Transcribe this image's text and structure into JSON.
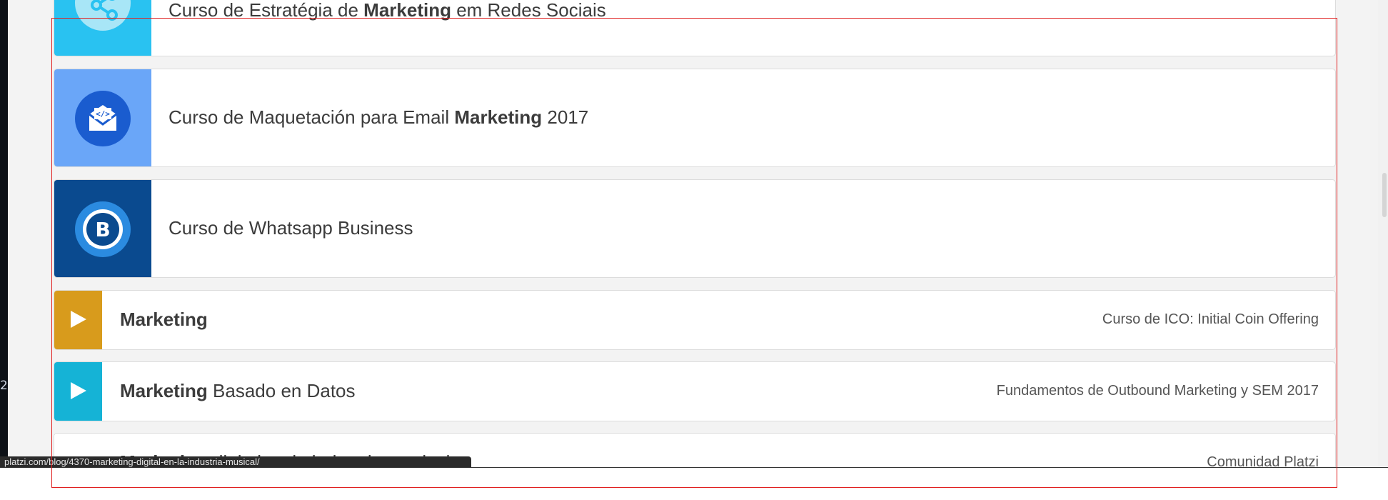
{
  "cards": [
    {
      "prefix": "Curso de Estratégia de ",
      "bold": "Marketing",
      "suffix": " em Redes Sociais",
      "icon": "share-icon",
      "thumb_color": "#29c2f1"
    },
    {
      "prefix": "Curso de Maquetación para Email ",
      "bold": "Marketing",
      "suffix": " 2017",
      "icon": "email-code-icon",
      "thumb_color": "#6aa6f8"
    },
    {
      "prefix": "Curso de Whatsapp Business",
      "bold": "",
      "suffix": "",
      "icon": "whatsapp-business-icon",
      "thumb_color": "#0a4a8f"
    }
  ],
  "rows": [
    {
      "bold": "Marketing",
      "rest": "",
      "meta": "Curso de ICO: Initial Coin Offering",
      "color": "#d89b1c",
      "icon": "play-icon"
    },
    {
      "bold": "Marketing",
      "rest": " Basado en Datos",
      "meta": "Fundamentos de Outbound Marketing y SEM 2017",
      "color": "#15b3d6",
      "icon": "play-icon"
    },
    {
      "bold": "Marketing",
      "rest": " digital en la industria musical",
      "meta": "Comunidad Platzi",
      "color": "#ffffff",
      "icon": "play-icon"
    }
  ],
  "status_url": "platzi.com/blog/4370-marketing-digital-en-la-industria-musical/",
  "left_edge_marker": "2",
  "colors": {
    "selection_box": "#e02020",
    "brand_blue": "#1a5ccf"
  }
}
